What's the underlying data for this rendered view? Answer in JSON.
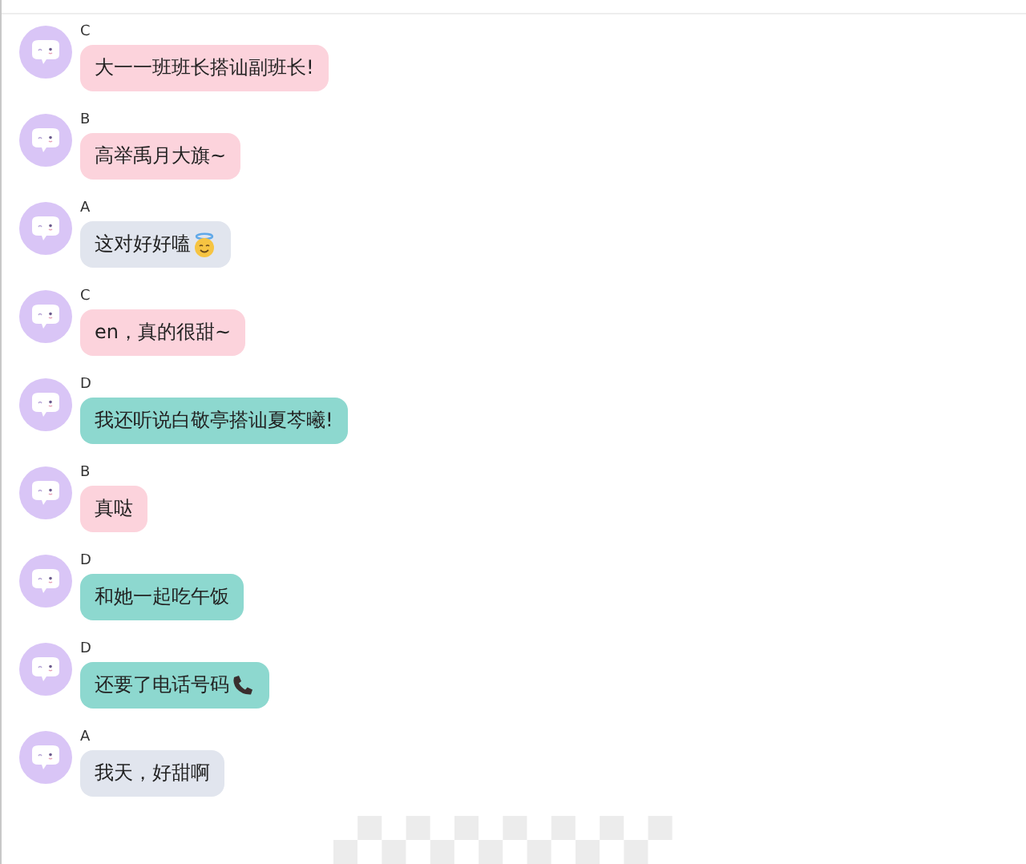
{
  "messages": [
    {
      "kind": "plain",
      "sender": "C",
      "text": "大一一班班长搭讪副班长!",
      "color": "#fcd3dc"
    },
    {
      "kind": "plain",
      "sender": "B",
      "text": "高举禹月大旗~",
      "color": "#fcd3dc"
    },
    {
      "kind": "halo",
      "sender": "A",
      "text": "这对好好嗑",
      "color": "#e1e5ee"
    },
    {
      "kind": "plain",
      "sender": "C",
      "text": "en，真的很甜~",
      "color": "#fcd3dc"
    },
    {
      "kind": "plain",
      "sender": "D",
      "text": "我还听说白敬亭搭讪夏芩曦!",
      "color": "#8dd8cf"
    },
    {
      "kind": "plain",
      "sender": "B",
      "text": "真哒",
      "color": "#fcd3dc"
    },
    {
      "kind": "plain",
      "sender": "D",
      "text": "和她一起吃午饭",
      "color": "#8dd8cf"
    },
    {
      "kind": "phone",
      "sender": "D",
      "text": "还要了电话号码",
      "color": "#8dd8cf"
    },
    {
      "kind": "plain",
      "sender": "A",
      "text": "我天，好甜啊",
      "color": "#e1e5ee"
    }
  ]
}
